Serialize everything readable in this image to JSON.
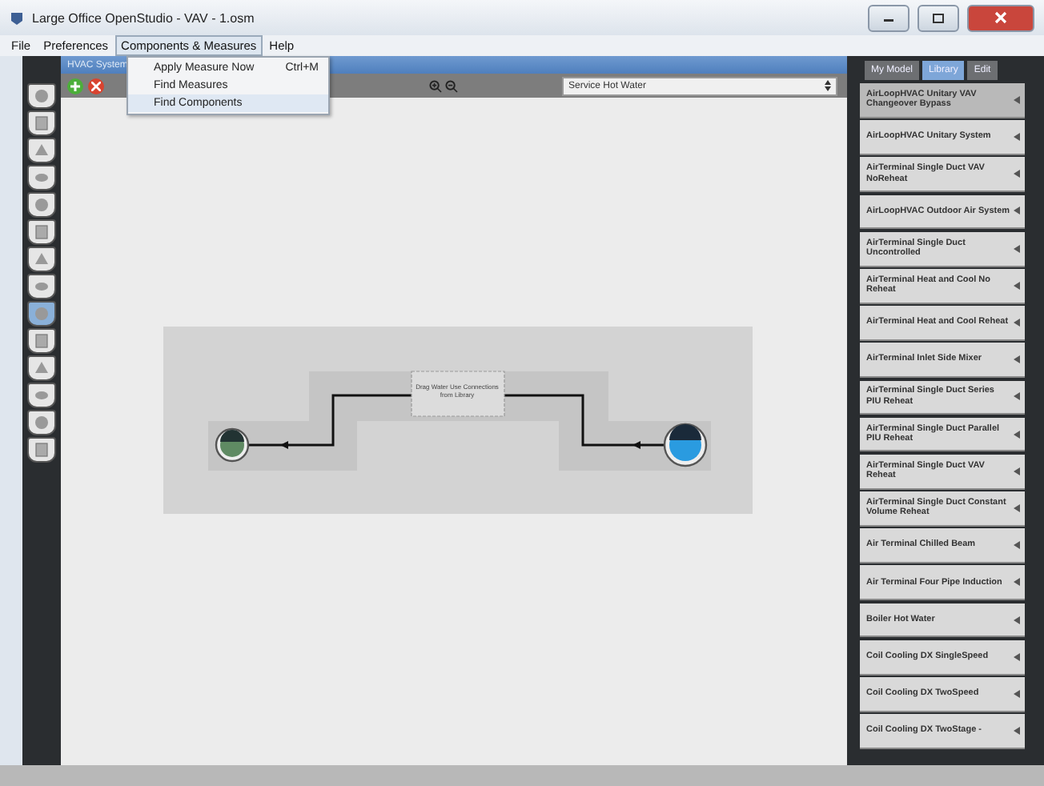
{
  "window": {
    "title": "Large Office OpenStudio - VAV - 1.osm"
  },
  "menu_bar": [
    {
      "label": "File",
      "selected": false
    },
    {
      "label": "Preferences",
      "selected": false
    },
    {
      "label": "Components & Measures",
      "selected": true
    },
    {
      "label": "Help",
      "selected": false
    }
  ],
  "open_menu": {
    "items": [
      {
        "label": "Apply Measure Now",
        "shortcut": "Ctrl+M",
        "selected": false
      },
      {
        "label": "Find Measures",
        "selected": false
      },
      {
        "label": "Find Components",
        "selected": true
      }
    ]
  },
  "side_tabs": [
    {
      "selected": false
    },
    {
      "selected": false
    },
    {
      "selected": false
    },
    {
      "selected": false
    },
    {
      "selected": false
    },
    {
      "selected": false
    },
    {
      "selected": false
    },
    {
      "selected": false
    },
    {
      "selected": true
    },
    {
      "selected": false
    },
    {
      "selected": false
    },
    {
      "selected": false
    },
    {
      "selected": false
    },
    {
      "selected": false
    }
  ],
  "main": {
    "header": "HVAC System",
    "loop_select": {
      "value": "Service Hot Water"
    },
    "diagram": {
      "node": "Drag Water Use Connections from Library"
    }
  },
  "right_panel": {
    "tabs": [
      {
        "label": "My Model",
        "selected": false
      },
      {
        "label": "Library",
        "selected": true
      },
      {
        "label": "Edit",
        "selected": false
      }
    ],
    "items": [
      {
        "label": "AirLoopHVAC Unitary VAV Changeover Bypass",
        "selected": true
      },
      {
        "label": "AirLoopHVAC Unitary System",
        "selected": false
      },
      {
        "label": "AirTerminal Single Duct VAV NoReheat",
        "selected": false
      },
      {
        "label": "AirLoopHVAC Outdoor Air System",
        "selected": false
      },
      {
        "label": "AirTerminal Single Duct Uncontrolled",
        "selected": false
      },
      {
        "label": "AirTerminal Heat and Cool No Reheat",
        "selected": false
      },
      {
        "label": "AirTerminal Heat and Cool Reheat",
        "selected": false
      },
      {
        "label": "AirTerminal Inlet Side Mixer",
        "selected": false
      },
      {
        "label": "AirTerminal Single Duct Series PIU Reheat",
        "selected": false
      },
      {
        "label": "AirTerminal Single Duct Parallel PIU Reheat",
        "selected": false
      },
      {
        "label": "AirTerminal Single Duct VAV Reheat",
        "selected": false
      },
      {
        "label": "AirTerminal Single Duct Constant Volume Reheat",
        "selected": false
      },
      {
        "label": "Air Terminal Chilled Beam",
        "selected": false
      },
      {
        "label": "Air Terminal Four Pipe Induction",
        "selected": false
      },
      {
        "label": "Boiler Hot Water",
        "selected": false
      },
      {
        "label": "Coil Cooling DX SingleSpeed",
        "selected": false
      },
      {
        "label": "Coil Cooling DX TwoSpeed",
        "selected": false
      },
      {
        "label": "Coil Cooling DX TwoStage -",
        "selected": false
      }
    ]
  }
}
